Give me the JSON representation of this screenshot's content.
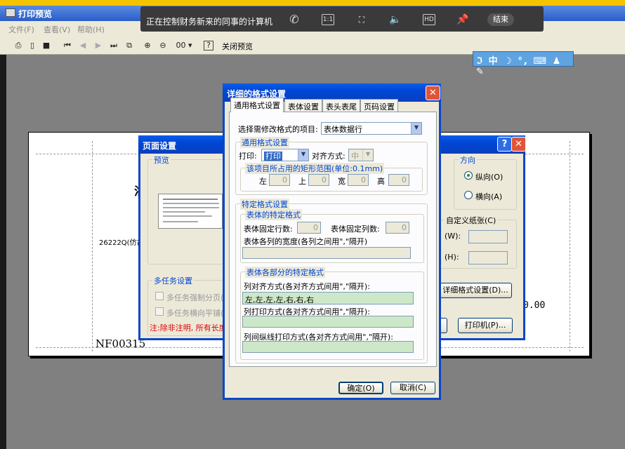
{
  "main_window": {
    "title": "打印预览"
  },
  "menu": [
    {
      "label": "文件(F)"
    },
    {
      "label": "查看(V)"
    },
    {
      "label": "帮助(H)"
    }
  ],
  "toolbar": {
    "zoom_value": "00",
    "close_preview_label": "关闭预览"
  },
  "remote_bar": {
    "title": "正在控制财务新来的同事的计算机",
    "ratio_label": "1:1",
    "hd_label": "HD",
    "end_label": "结束"
  },
  "ime": {
    "mode_label": "中"
  },
  "paper": {
    "text_code": "26222Q(仿古)",
    "text_nf": "NF00315",
    "text_amount": "0.00",
    "text_partial": "浴"
  },
  "page_setup": {
    "title": "页面设置",
    "preview_label": "预览",
    "orientation_label": "方向",
    "portrait_label": "纵向(O)",
    "landscape_label": "横向(A)",
    "custom_paper_label": "自定义纸张(C)",
    "width_label": "(W):",
    "height_label": "(H):",
    "detail_button": "详细格式设置(D)...",
    "printer_button": "打印机(P)...",
    "multitask_label": "多任务设置",
    "force_page_label": "多任务强制分页(B)",
    "horizontal_label": "多任务横向平铺(I)",
    "note": "注:除非注明, 所有长度"
  },
  "format_dialog": {
    "title": "详细的格式设置",
    "tabs": [
      {
        "label": "通用格式设置"
      },
      {
        "label": "表体设置"
      },
      {
        "label": "表头表尾"
      },
      {
        "label": "页码设置"
      }
    ],
    "select_item_label": "选择需修改格式的项目:",
    "select_item_value": "表体数据行",
    "general_group": "通用格式设置",
    "print_label": "打印:",
    "print_value": "打印",
    "align_label": "对齐方式:",
    "align_value": "中",
    "rect_label": "该项目所占用的矩形范围(单位:0.1mm)",
    "left_label": "左",
    "left_value": "0",
    "top_label": "上",
    "top_value": "0",
    "width_label": "宽",
    "width_value": "0",
    "height_label": "高",
    "height_value": "0",
    "special_group": "特定格式设置",
    "body_special": "表体的特定格式",
    "fixed_rows_label": "表体固定行数:",
    "fixed_rows_value": "0",
    "fixed_cols_label": "表体固定列数:",
    "fixed_cols_value": "0",
    "col_width_label": "表体各列的宽度(各列之间用\",\"隔开)",
    "parts_group": "表体各部分的特定格式",
    "col_align_label": "列对齐方式(各对齐方式间用\",\"隔开):",
    "col_align_value": "左,左,左,左,右,右,右",
    "col_print_label": "列打印方式(各对齐方式间用\",\"隔开):",
    "col_line_label": "列间纵线打印方式(各对齐方式间用\",\"隔开):",
    "ok_button": "确定(O)",
    "cancel_button": "取消(C)"
  }
}
